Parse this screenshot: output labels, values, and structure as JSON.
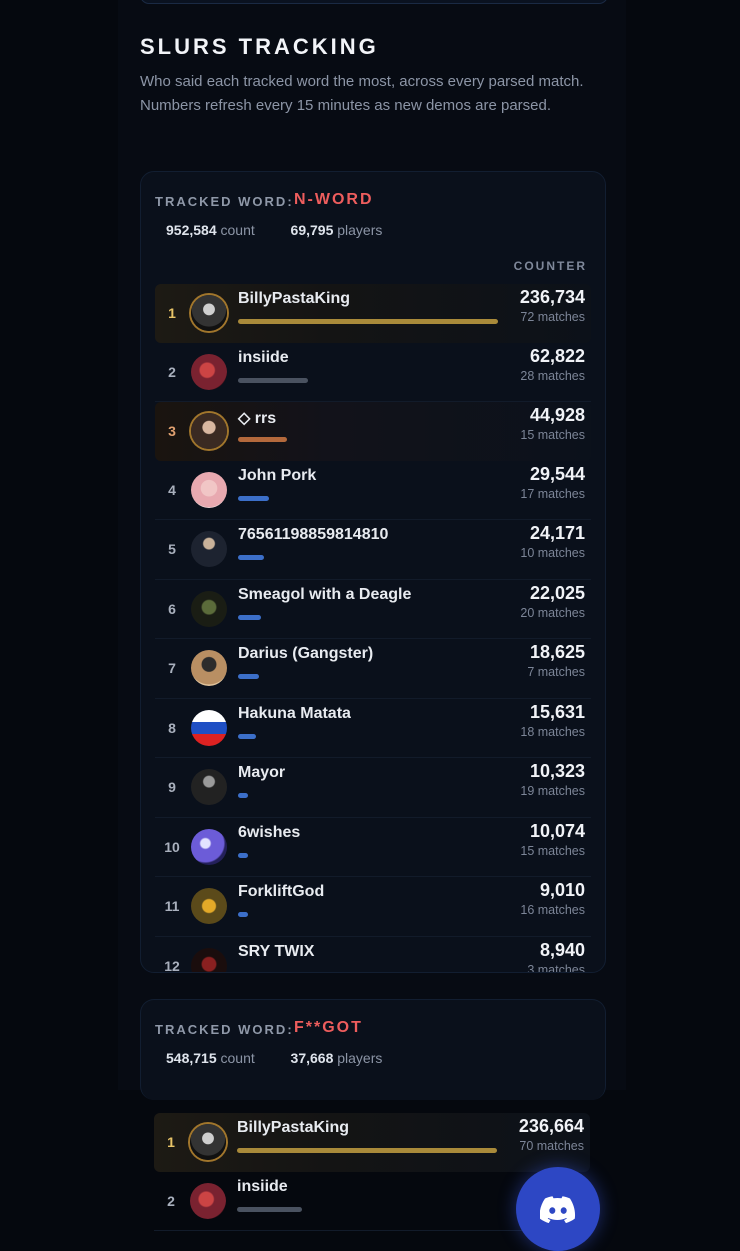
{
  "section": {
    "title": "SLURS TRACKING",
    "description": "Who said each tracked word the most, across every parsed match. Numbers refresh every 15 minutes as new demos are parsed."
  },
  "cards": [
    {
      "label": "TRACKED WORD:",
      "word": "N-WORD",
      "count_value": "952,584",
      "count_label": "count",
      "players_value": "69,795",
      "players_label": "players",
      "counter_header": "COUNTER",
      "rows": [
        {
          "rank": "1",
          "name": "BillyPastaKing",
          "count": "236,734",
          "matches": "72 matches",
          "bar": 1.0
        },
        {
          "rank": "2",
          "name": "insiide",
          "count": "62,822",
          "matches": "28 matches",
          "bar": 0.27
        },
        {
          "rank": "3",
          "name": "◇ rrs",
          "count": "44,928",
          "matches": "15 matches",
          "bar": 0.19
        },
        {
          "rank": "4",
          "name": "John Pork",
          "count": "29,544",
          "matches": "17 matches",
          "bar": 0.12
        },
        {
          "rank": "5",
          "name": "76561198859814810",
          "count": "24,171",
          "matches": "10 matches",
          "bar": 0.1
        },
        {
          "rank": "6",
          "name": "Smeagol with a Deagle",
          "count": "22,025",
          "matches": "20 matches",
          "bar": 0.09
        },
        {
          "rank": "7",
          "name": "Darius (Gangster)",
          "count": "18,625",
          "matches": "7 matches",
          "bar": 0.08
        },
        {
          "rank": "8",
          "name": "Hakuna Matata",
          "count": "15,631",
          "matches": "18 matches",
          "bar": 0.07
        },
        {
          "rank": "9",
          "name": "Mayor",
          "count": "10,323",
          "matches": "19 matches",
          "bar": 0.04
        },
        {
          "rank": "10",
          "name": "6wishes",
          "count": "10,074",
          "matches": "15 matches",
          "bar": 0.04
        },
        {
          "rank": "11",
          "name": "ForkliftGod",
          "count": "9,010",
          "matches": "16 matches",
          "bar": 0.04
        },
        {
          "rank": "12",
          "name": "SRY TWIX",
          "count": "8,940",
          "matches": "3 matches",
          "bar": 0.04
        }
      ]
    },
    {
      "label": "TRACKED WORD:",
      "word": "F**GOT",
      "count_value": "548,715",
      "count_label": "count",
      "players_value": "37,668",
      "players_label": "players",
      "rows": [
        {
          "rank": "1",
          "name": "BillyPastaKing",
          "count": "236,664",
          "matches": "70 matches",
          "bar": 1.0
        },
        {
          "rank": "2",
          "name": "insiide",
          "count": "",
          "matches": "",
          "bar": 0.25
        }
      ]
    }
  ],
  "colors": {
    "accent_red": "#ee5d5d",
    "gold_bar": "#a98a3a",
    "bronze_bar": "#b4693c",
    "blue_bar": "#3c6fc9",
    "silver_bar": "#4a5260",
    "discord": "#2d47c4"
  },
  "icons": {
    "discord": "discord-icon"
  }
}
